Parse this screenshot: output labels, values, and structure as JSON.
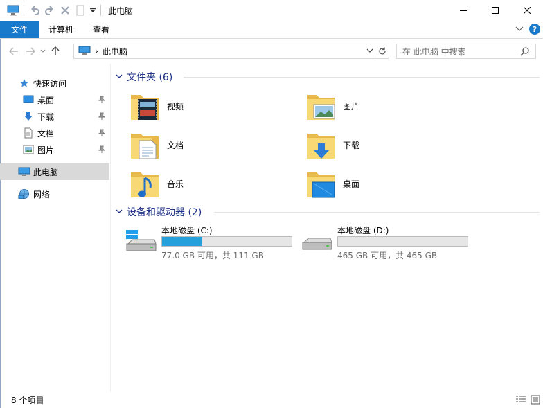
{
  "window": {
    "title": "此电脑"
  },
  "ribbon": {
    "tabs": [
      {
        "label": "文件",
        "active": true
      },
      {
        "label": "计算机"
      },
      {
        "label": "查看"
      }
    ],
    "help": "?"
  },
  "address": {
    "path": "此电脑",
    "separator": "›"
  },
  "search": {
    "placeholder": "在 此电脑 中搜索"
  },
  "sidebar": {
    "quick_access": "快速访问",
    "items": [
      {
        "label": "桌面",
        "icon": "desktop-icon",
        "pinned": true
      },
      {
        "label": "下载",
        "icon": "download-icon",
        "pinned": true
      },
      {
        "label": "文档",
        "icon": "document-icon",
        "pinned": true
      },
      {
        "label": "图片",
        "icon": "picture-icon",
        "pinned": true
      }
    ],
    "this_pc": "此电脑",
    "network": "网络"
  },
  "folders_group": {
    "header": "文件夹 (6)",
    "folders": [
      {
        "name": "视频",
        "icon": "video-folder-icon"
      },
      {
        "name": "图片",
        "icon": "picture-folder-icon"
      },
      {
        "name": "文档",
        "icon": "document-folder-icon"
      },
      {
        "name": "下载",
        "icon": "download-folder-icon"
      },
      {
        "name": "音乐",
        "icon": "music-folder-icon"
      },
      {
        "name": "桌面",
        "icon": "desktop-folder-icon"
      }
    ]
  },
  "drives_group": {
    "header": "设备和驱动器 (2)",
    "drives": [
      {
        "name": "本地磁盘 (C:)",
        "free_text": "77.0 GB 可用，共 111 GB",
        "used_fraction": 0.31,
        "system": true
      },
      {
        "name": "本地磁盘 (D:)",
        "free_text": "465 GB 可用，共 465 GB",
        "used_fraction": 0.0,
        "system": false
      }
    ]
  },
  "status": {
    "item_count": "8 个项目"
  },
  "colors": {
    "accent": "#1979ca",
    "header_text": "#1e3287",
    "drive_fill": "#26a0da",
    "folder": "#f8d775"
  }
}
